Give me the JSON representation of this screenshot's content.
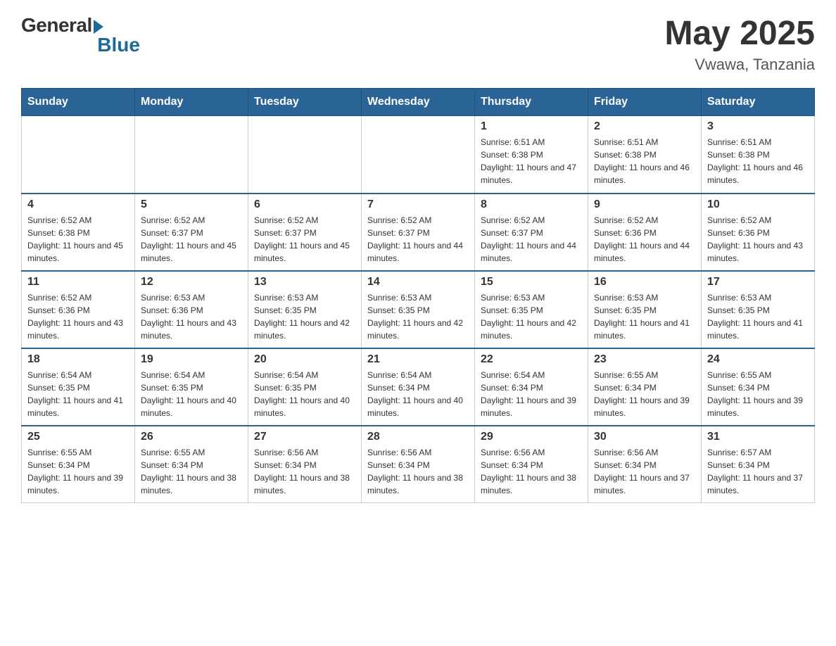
{
  "header": {
    "logo_general": "General",
    "logo_blue": "Blue",
    "month_year": "May 2025",
    "location": "Vwawa, Tanzania"
  },
  "days_of_week": [
    "Sunday",
    "Monday",
    "Tuesday",
    "Wednesday",
    "Thursday",
    "Friday",
    "Saturday"
  ],
  "weeks": [
    [
      {
        "day": "",
        "info": ""
      },
      {
        "day": "",
        "info": ""
      },
      {
        "day": "",
        "info": ""
      },
      {
        "day": "",
        "info": ""
      },
      {
        "day": "1",
        "info": "Sunrise: 6:51 AM\nSunset: 6:38 PM\nDaylight: 11 hours and 47 minutes."
      },
      {
        "day": "2",
        "info": "Sunrise: 6:51 AM\nSunset: 6:38 PM\nDaylight: 11 hours and 46 minutes."
      },
      {
        "day": "3",
        "info": "Sunrise: 6:51 AM\nSunset: 6:38 PM\nDaylight: 11 hours and 46 minutes."
      }
    ],
    [
      {
        "day": "4",
        "info": "Sunrise: 6:52 AM\nSunset: 6:38 PM\nDaylight: 11 hours and 45 minutes."
      },
      {
        "day": "5",
        "info": "Sunrise: 6:52 AM\nSunset: 6:37 PM\nDaylight: 11 hours and 45 minutes."
      },
      {
        "day": "6",
        "info": "Sunrise: 6:52 AM\nSunset: 6:37 PM\nDaylight: 11 hours and 45 minutes."
      },
      {
        "day": "7",
        "info": "Sunrise: 6:52 AM\nSunset: 6:37 PM\nDaylight: 11 hours and 44 minutes."
      },
      {
        "day": "8",
        "info": "Sunrise: 6:52 AM\nSunset: 6:37 PM\nDaylight: 11 hours and 44 minutes."
      },
      {
        "day": "9",
        "info": "Sunrise: 6:52 AM\nSunset: 6:36 PM\nDaylight: 11 hours and 44 minutes."
      },
      {
        "day": "10",
        "info": "Sunrise: 6:52 AM\nSunset: 6:36 PM\nDaylight: 11 hours and 43 minutes."
      }
    ],
    [
      {
        "day": "11",
        "info": "Sunrise: 6:52 AM\nSunset: 6:36 PM\nDaylight: 11 hours and 43 minutes."
      },
      {
        "day": "12",
        "info": "Sunrise: 6:53 AM\nSunset: 6:36 PM\nDaylight: 11 hours and 43 minutes."
      },
      {
        "day": "13",
        "info": "Sunrise: 6:53 AM\nSunset: 6:35 PM\nDaylight: 11 hours and 42 minutes."
      },
      {
        "day": "14",
        "info": "Sunrise: 6:53 AM\nSunset: 6:35 PM\nDaylight: 11 hours and 42 minutes."
      },
      {
        "day": "15",
        "info": "Sunrise: 6:53 AM\nSunset: 6:35 PM\nDaylight: 11 hours and 42 minutes."
      },
      {
        "day": "16",
        "info": "Sunrise: 6:53 AM\nSunset: 6:35 PM\nDaylight: 11 hours and 41 minutes."
      },
      {
        "day": "17",
        "info": "Sunrise: 6:53 AM\nSunset: 6:35 PM\nDaylight: 11 hours and 41 minutes."
      }
    ],
    [
      {
        "day": "18",
        "info": "Sunrise: 6:54 AM\nSunset: 6:35 PM\nDaylight: 11 hours and 41 minutes."
      },
      {
        "day": "19",
        "info": "Sunrise: 6:54 AM\nSunset: 6:35 PM\nDaylight: 11 hours and 40 minutes."
      },
      {
        "day": "20",
        "info": "Sunrise: 6:54 AM\nSunset: 6:35 PM\nDaylight: 11 hours and 40 minutes."
      },
      {
        "day": "21",
        "info": "Sunrise: 6:54 AM\nSunset: 6:34 PM\nDaylight: 11 hours and 40 minutes."
      },
      {
        "day": "22",
        "info": "Sunrise: 6:54 AM\nSunset: 6:34 PM\nDaylight: 11 hours and 39 minutes."
      },
      {
        "day": "23",
        "info": "Sunrise: 6:55 AM\nSunset: 6:34 PM\nDaylight: 11 hours and 39 minutes."
      },
      {
        "day": "24",
        "info": "Sunrise: 6:55 AM\nSunset: 6:34 PM\nDaylight: 11 hours and 39 minutes."
      }
    ],
    [
      {
        "day": "25",
        "info": "Sunrise: 6:55 AM\nSunset: 6:34 PM\nDaylight: 11 hours and 39 minutes."
      },
      {
        "day": "26",
        "info": "Sunrise: 6:55 AM\nSunset: 6:34 PM\nDaylight: 11 hours and 38 minutes."
      },
      {
        "day": "27",
        "info": "Sunrise: 6:56 AM\nSunset: 6:34 PM\nDaylight: 11 hours and 38 minutes."
      },
      {
        "day": "28",
        "info": "Sunrise: 6:56 AM\nSunset: 6:34 PM\nDaylight: 11 hours and 38 minutes."
      },
      {
        "day": "29",
        "info": "Sunrise: 6:56 AM\nSunset: 6:34 PM\nDaylight: 11 hours and 38 minutes."
      },
      {
        "day": "30",
        "info": "Sunrise: 6:56 AM\nSunset: 6:34 PM\nDaylight: 11 hours and 37 minutes."
      },
      {
        "day": "31",
        "info": "Sunrise: 6:57 AM\nSunset: 6:34 PM\nDaylight: 11 hours and 37 minutes."
      }
    ]
  ]
}
